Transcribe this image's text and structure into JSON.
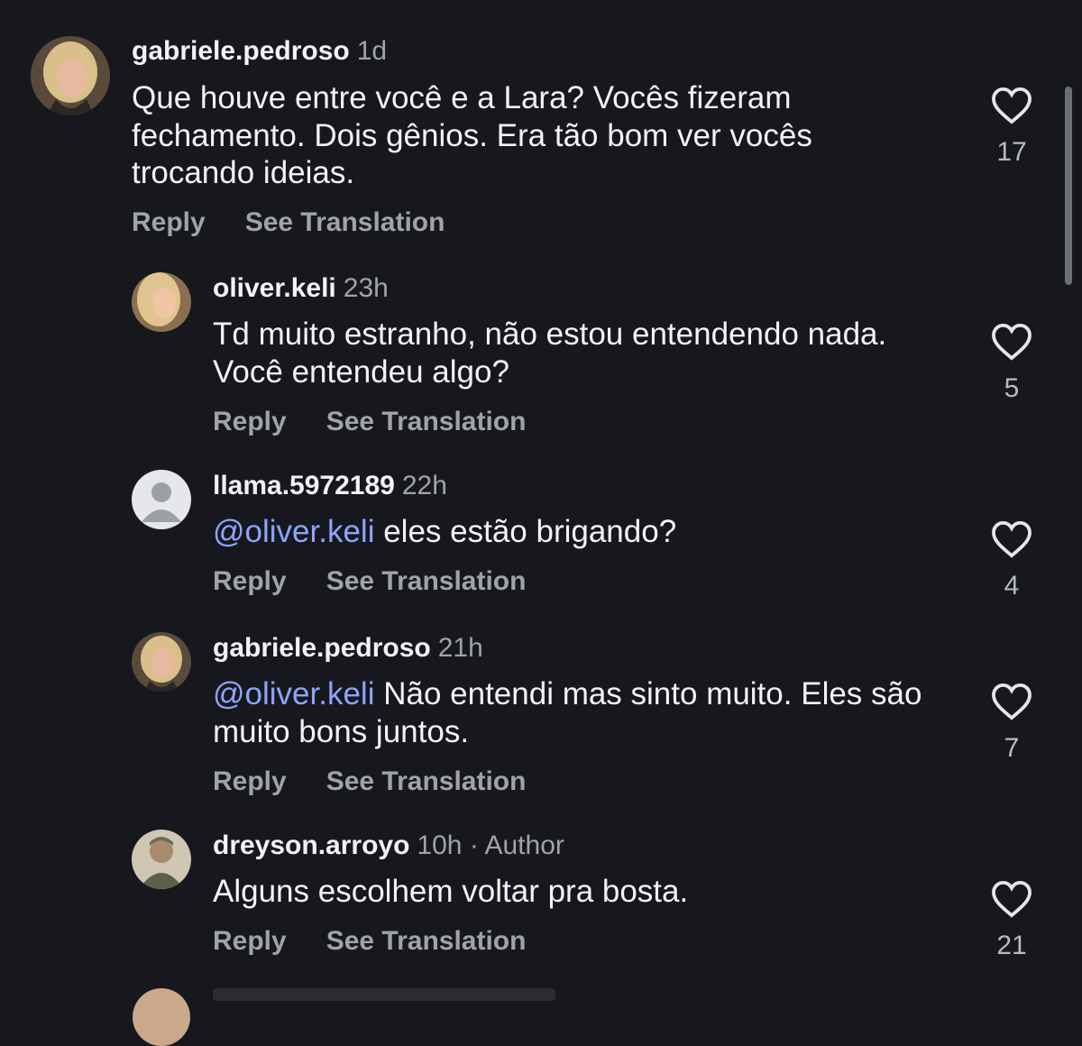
{
  "comments": [
    {
      "username": "gabriele.pedroso",
      "time": "1d",
      "text": "Que houve entre você e a Lara? Vocês fizeram fechamento.  Dois gênios. Era tão bom ver vocês trocando ideias.",
      "reply_label": "Reply",
      "translate_label": "See Translation",
      "likes": "17"
    },
    {
      "username": "oliver.keli",
      "time": "23h",
      "text": "Td muito estranho, não estou entendendo nada. Você entendeu algo?",
      "reply_label": "Reply",
      "translate_label": "See Translation",
      "likes": "5"
    },
    {
      "username": "llama.5972189",
      "time": "22h",
      "mention": "@oliver.keli",
      "text": " eles estão brigando?",
      "reply_label": "Reply",
      "translate_label": "See Translation",
      "likes": "4"
    },
    {
      "username": "gabriele.pedroso",
      "time": "21h",
      "mention": "@oliver.keli",
      "text": " Não entendi mas sinto muito. Eles são muito bons juntos.",
      "reply_label": "Reply",
      "translate_label": "See Translation",
      "likes": "7"
    },
    {
      "username": "dreyson.arroyo",
      "time": "10h",
      "author_badge": " · Author",
      "text": "Alguns escolhem voltar pra bosta.",
      "reply_label": "Reply",
      "translate_label": "See Translation",
      "likes": "21"
    }
  ],
  "icons": {
    "like": "heart-outline-icon",
    "avatar_default": "person-placeholder-icon"
  },
  "colors": {
    "background": "#16181d",
    "mention": "#8ea4ff",
    "secondary_text": "#a0a3aa"
  }
}
